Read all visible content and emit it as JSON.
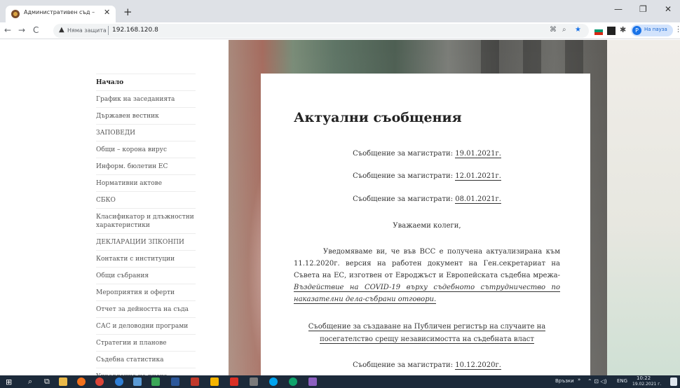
{
  "browser": {
    "tab_title": "Административен съд – Пазардж",
    "close_glyph": "✕",
    "new_tab_glyph": "+",
    "minimize_glyph": "—",
    "maximize_glyph": "❐",
    "window_close_glyph": "✕",
    "back_glyph": "←",
    "forward_glyph": "→",
    "reload_glyph": "C",
    "security_label": "Няма защита",
    "url": "192.168.120.8",
    "profile_initial": "P",
    "profile_label": "На пауза",
    "menu_glyph": "⋮"
  },
  "sidebar": {
    "items": [
      {
        "label": "Начало",
        "active": true
      },
      {
        "label": "График на заседанията"
      },
      {
        "label": "Държавен вестник"
      },
      {
        "label": "ЗАПОВЕДИ"
      },
      {
        "label": "Общи – корона вирус"
      },
      {
        "label": "Информ. бюлетин ЕС"
      },
      {
        "label": "Нормативни актове"
      },
      {
        "label": "СБКО"
      },
      {
        "label": "Класификатор и длъжностни характеристики"
      },
      {
        "label": "ДЕКЛАРАЦИИ ЗПКОНПИ"
      },
      {
        "label": "Контакти с институции"
      },
      {
        "label": "Общи събрания"
      },
      {
        "label": "Мероприятия и оферти"
      },
      {
        "label": "Отчет за дейността на съда"
      },
      {
        "label": "САС и деловодни програми"
      },
      {
        "label": "Стратегии и планове"
      },
      {
        "label": "Съдебна статистика"
      },
      {
        "label": "Управление на риска"
      }
    ]
  },
  "content": {
    "title": "Актуални съобщения",
    "messages": [
      {
        "prefix": "Съобщение за магистрати:",
        "link": "19.01.2021г."
      },
      {
        "prefix": "Съобщение за магистрати:",
        "link": "12.01.2021г."
      },
      {
        "prefix": "Съобщение за магистрати:",
        "link": "08.01.2021г."
      }
    ],
    "greeting": "Уважаеми колеги,",
    "paragraph_text": "Уведомяваме ви, че във ВСС е получена актуализирана към 11.12.2020г. версия на работен документ на Ген.секретариат на Съвета на ЕС, изготвен от Евроджъст и Европейската съдебна мрежа-",
    "paragraph_link": "Въздействие на COVID-19 върху съдебното сътрудничество по наказателни дела-събрани отговори.",
    "notice_link": "Съобщение за създаване на Публичен регистър на случаите на посегателство срещу независимостта на съдебната власт",
    "last_message": {
      "prefix": "Съобщение за магистрати:",
      "link": "10.12.2020г."
    }
  },
  "taskbar": {
    "start_glyph": "⊞",
    "search_glyph": "⌕",
    "taskview_glyph": "⧉",
    "links_label": "Връзки",
    "expand_glyph": "»",
    "tray_glyphs": "⌃ ⊡ ◁)",
    "language": "ENG",
    "time": "10:22",
    "date": "19.02.2021 г."
  },
  "colors": {
    "accent": "#1a73e8",
    "taskbar": "#1c2a3a",
    "text": "#333333"
  }
}
